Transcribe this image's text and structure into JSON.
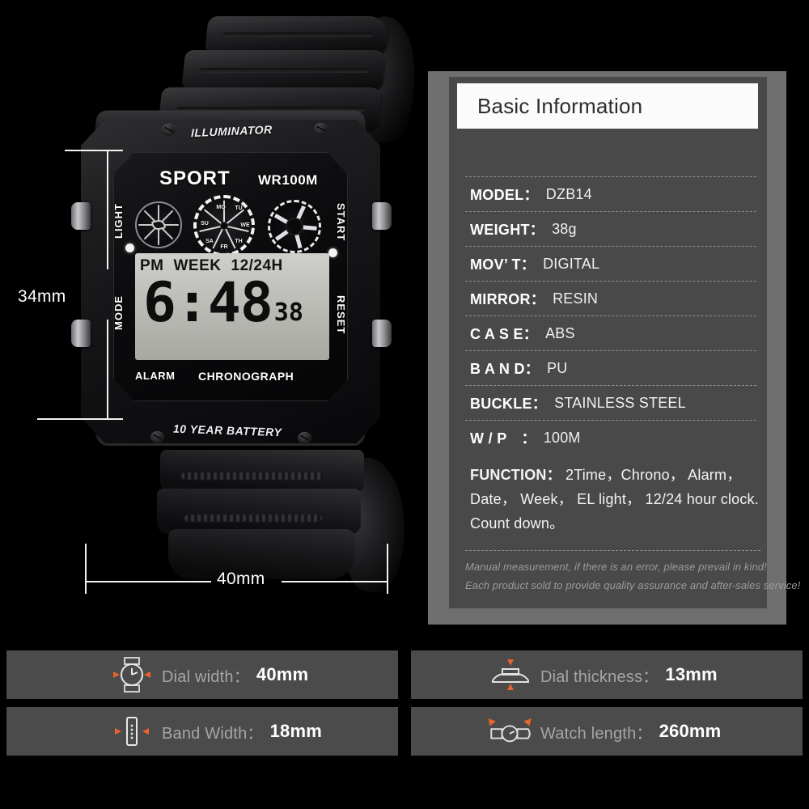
{
  "product_photo": {
    "bezel_top_text": "ILLUMINATOR",
    "bezel_bottom_text": "10 YEAR BATTERY",
    "dial": {
      "brand": "SPORT",
      "water_resistance": "WR100M",
      "left_button_label": "LIGHT",
      "left_button_label_2": "MODE",
      "right_button_label": "START",
      "right_button_label_2": "RESET",
      "bottom_left_text": "ALARM",
      "bottom_right_text": "CHRONOGRAPH",
      "lcd": {
        "meridiem": "PM",
        "week_label": "WEEK",
        "format_label": "12/24H",
        "time": "6:48",
        "seconds": "38"
      },
      "weekday_ring": [
        "MO",
        "TU",
        "WE",
        "TH",
        "FR",
        "SA",
        "SU"
      ]
    },
    "dimensions": {
      "height_label": "34mm",
      "width_label": "40mm"
    }
  },
  "spec_panel": {
    "header_title": "Basic Information",
    "rows": [
      {
        "key": "MODEL：",
        "value": "DZB14"
      },
      {
        "key": "WEIGHT：",
        "value": "38g"
      },
      {
        "key": "MOV’ T：",
        "value": "DIGITAL"
      },
      {
        "key": "MIRROR：",
        "value": "RESIN"
      },
      {
        "key": "C A S E：",
        "value": "ABS"
      },
      {
        "key": "B A N D：",
        "value": "PU"
      },
      {
        "key": "BUCKLE：",
        "value": "STAINLESS STEEL"
      },
      {
        "key": "W / P　：",
        "value": "100M"
      }
    ],
    "function": {
      "key": "FUNCTION：",
      "line1_value": "2Time，Chrono， Alarm，",
      "line2": "Date， Week， EL light， 12/24 hour clock.",
      "line3": "Count down。"
    },
    "notes": [
      "Manual measurement, if there is an error, please prevail in kind!",
      "Each product sold to provide quality assurance and after-sales service!"
    ]
  },
  "measurement_bars": [
    {
      "icon": "watch-dial-icon",
      "label": "Dial width：",
      "value": "40mm"
    },
    {
      "icon": "watch-profile-icon",
      "label": "Dial thickness：",
      "value": "13mm"
    },
    {
      "icon": "watch-band-icon",
      "label": "Band Width：",
      "value": "18mm"
    },
    {
      "icon": "watch-length-icon",
      "label": "Watch length：",
      "value": "260mm"
    }
  ],
  "colors": {
    "background": "#000000",
    "panel_frame": "#6f6f6f",
    "panel_inner": "#494949",
    "header_bg": "#fbfbfb",
    "bar_bg": "#4b4b4b",
    "accent_orange": "#e8642a",
    "text_primary": "#ffffff",
    "text_muted": "#a6a6a6"
  }
}
